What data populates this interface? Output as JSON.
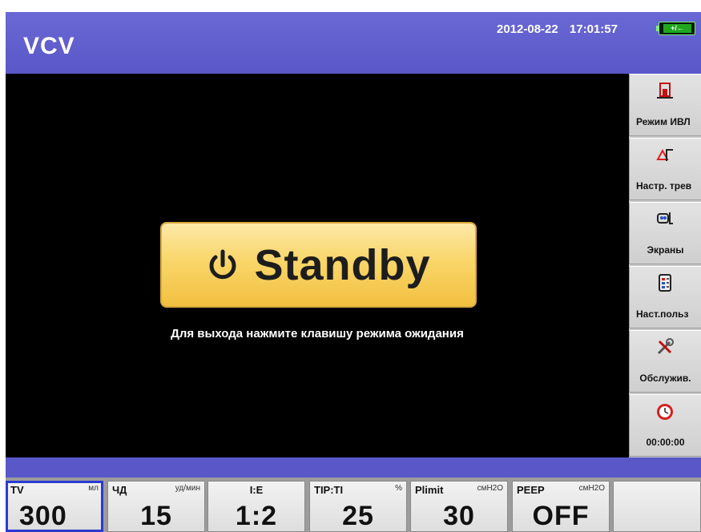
{
  "header": {
    "mode": "VCV",
    "date": "2012-08-22",
    "time": "17:01:57",
    "battery_label": "+/←"
  },
  "main": {
    "standby_label": "Standby",
    "standby_hint": "Для выхода нажмите клавишу режима ожидания"
  },
  "sidebar": {
    "items": [
      {
        "label": "Режим ИВЛ",
        "icon": "ventilation-mode-icon"
      },
      {
        "label": "Настр. трев",
        "icon": "alarm-settings-icon"
      },
      {
        "label": "Экраны",
        "icon": "screens-icon"
      },
      {
        "label": "Наст.польз",
        "icon": "user-settings-icon"
      },
      {
        "label": "Обслужив.",
        "icon": "service-tools-icon"
      },
      {
        "label": "00:00:00",
        "icon": "timer-clock-icon"
      }
    ]
  },
  "params": [
    {
      "name": "TV",
      "unit": "мл",
      "value": "300"
    },
    {
      "name": "ЧД",
      "unit": "уд/мин",
      "value": "15"
    },
    {
      "name": "I:E",
      "unit": "",
      "value": "1:2"
    },
    {
      "name": "TIP:TI",
      "unit": "%",
      "value": "25"
    },
    {
      "name": "Plimit",
      "unit": "смH2O",
      "value": "30"
    },
    {
      "name": "PEEP",
      "unit": "смH2O",
      "value": "OFF"
    }
  ],
  "colors": {
    "header_bg": "#5a58c8",
    "standby_gold": "#f9d66a",
    "active_param_border": "#2b3bd0",
    "battery_green": "#1ea81e"
  }
}
